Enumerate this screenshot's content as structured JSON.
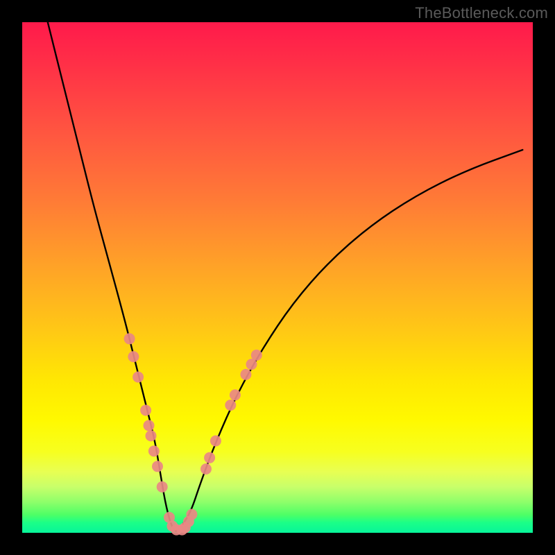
{
  "watermark": "TheBottleneck.com",
  "chart_data": {
    "type": "line",
    "title": "",
    "xlabel": "",
    "ylabel": "",
    "xlim": [
      0,
      100
    ],
    "ylim": [
      0,
      100
    ],
    "grid": false,
    "series": [
      {
        "name": "bottleneck-curve",
        "color": "#000000",
        "x": [
          5,
          8,
          11,
          14,
          17,
          20,
          22,
          24,
          26,
          27,
          28,
          29,
          30,
          31,
          33,
          35,
          38,
          42,
          47,
          53,
          60,
          68,
          77,
          87,
          98
        ],
        "y": [
          100,
          88,
          76,
          64,
          53,
          42,
          34,
          26,
          18,
          12,
          6,
          2,
          0,
          1,
          4,
          10,
          18,
          27,
          36,
          45,
          53,
          60,
          66,
          71,
          75
        ]
      }
    ],
    "markers": {
      "name": "highlight-points",
      "color": "#e98884",
      "radius_px": 8,
      "points": [
        {
          "x": 21.0,
          "y": 38.0
        },
        {
          "x": 21.8,
          "y": 34.5
        },
        {
          "x": 22.7,
          "y": 30.5
        },
        {
          "x": 24.2,
          "y": 24.0
        },
        {
          "x": 24.8,
          "y": 21.0
        },
        {
          "x": 25.2,
          "y": 19.0
        },
        {
          "x": 25.8,
          "y": 16.0
        },
        {
          "x": 26.5,
          "y": 13.0
        },
        {
          "x": 27.4,
          "y": 9.0
        },
        {
          "x": 28.8,
          "y": 3.0
        },
        {
          "x": 29.4,
          "y": 1.3
        },
        {
          "x": 30.2,
          "y": 0.6
        },
        {
          "x": 31.3,
          "y": 0.6
        },
        {
          "x": 31.9,
          "y": 1.0
        },
        {
          "x": 32.6,
          "y": 2.2
        },
        {
          "x": 33.2,
          "y": 3.6
        },
        {
          "x": 36.0,
          "y": 12.5
        },
        {
          "x": 36.7,
          "y": 14.7
        },
        {
          "x": 37.9,
          "y": 18.0
        },
        {
          "x": 40.8,
          "y": 25.0
        },
        {
          "x": 41.7,
          "y": 27.0
        },
        {
          "x": 43.8,
          "y": 31.0
        },
        {
          "x": 44.9,
          "y": 33.0
        },
        {
          "x": 45.9,
          "y": 34.8
        }
      ]
    }
  }
}
